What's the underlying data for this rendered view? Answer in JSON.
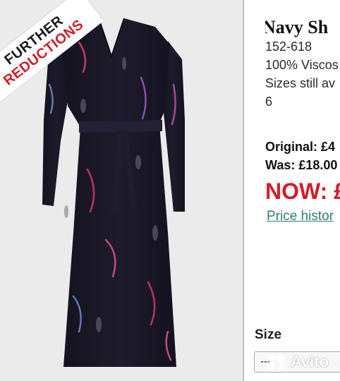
{
  "banner": {
    "line1": "FURTHER",
    "line2": "REDUCTIONS"
  },
  "product": {
    "title": "Navy Sh",
    "code": "152-618",
    "material": "100% Viscos",
    "sizes_note": "Sizes still av",
    "size_value": "6"
  },
  "pricing": {
    "original": "Original: £4",
    "was": "Was: £18.00",
    "now": "NOW: £",
    "history_link": "Price histor"
  },
  "size": {
    "label": "Size",
    "selected": "---"
  },
  "watermark": {
    "text": "Avito"
  },
  "colors": {
    "accent_red": "#d21e2a",
    "link_teal": "#2e7d7a",
    "dress_navy": "#1c1a2e"
  },
  "icons": {
    "watermark_logo": "avito-logo-icon"
  }
}
